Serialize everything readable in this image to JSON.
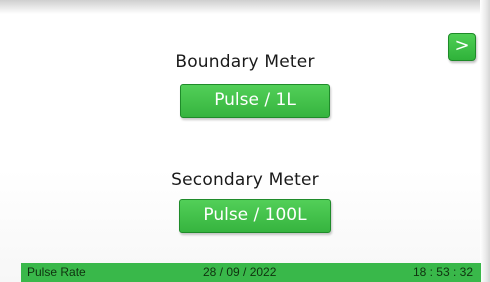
{
  "nav": {
    "next_label": ">"
  },
  "boundary_meter": {
    "title": "Boundary Meter",
    "pulse_label": "Pulse / 1L"
  },
  "secondary_meter": {
    "title": "Secondary Meter",
    "pulse_label": "Pulse / 100L"
  },
  "status_bar": {
    "label": "Pulse Rate",
    "date": "28 / 09 / 2022",
    "time": "18 : 53 : 32"
  },
  "colors": {
    "accent_green": "#39b84a",
    "button_border": "#1f8b2a",
    "background": "#ffffff"
  }
}
